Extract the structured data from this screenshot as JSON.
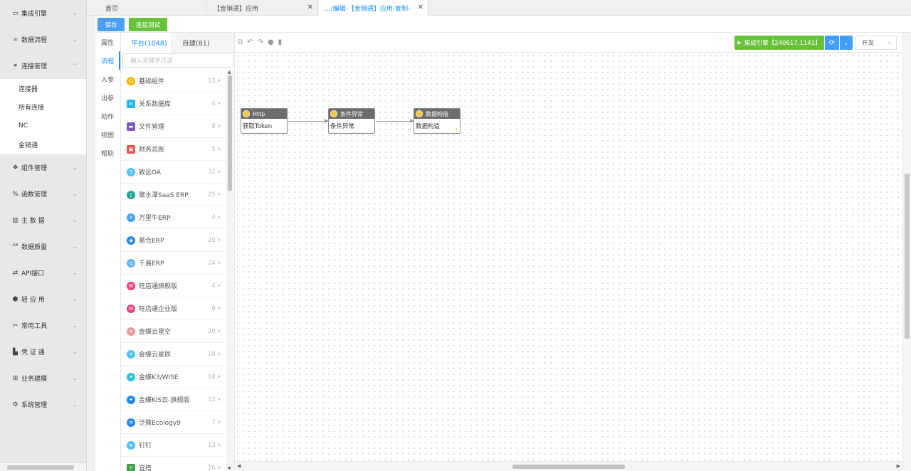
{
  "sidenav": {
    "items": [
      {
        "label": "集成引擎",
        "icon": "engine-icon"
      },
      {
        "label": "数据流程",
        "icon": "infinity-icon"
      },
      {
        "label": "连接管理",
        "icon": "link-icon",
        "expanded": true
      },
      {
        "label": "组件管理",
        "icon": "component-icon"
      },
      {
        "label": "函数管理",
        "icon": "percent-icon"
      },
      {
        "label": "主 数 据",
        "icon": "book-icon"
      },
      {
        "label": "数据质量",
        "icon": "ab-icon"
      },
      {
        "label": "API接口",
        "icon": "swap-icon"
      },
      {
        "label": "轻 应 用",
        "icon": "cube-icon"
      },
      {
        "label": "常用工具",
        "icon": "tools-icon"
      },
      {
        "label": "凭 证 通",
        "icon": "voucher-icon"
      },
      {
        "label": "业务建模",
        "icon": "table-icon"
      },
      {
        "label": "系统管理",
        "icon": "gear-icon"
      }
    ],
    "sub_items": [
      "连接器",
      "所有连接",
      "NC",
      "金销通"
    ]
  },
  "tabs": [
    {
      "label": "首页"
    },
    {
      "label": "【金销通】应用"
    },
    {
      "label": ".../编辑-【金销通】应用-复制-"
    }
  ],
  "toolbar": {
    "save": "保存",
    "test": "连接测试"
  },
  "vtabs": [
    "属性",
    "流程",
    "入参",
    "出参",
    "动作",
    "视图",
    "帮助"
  ],
  "components": {
    "tab_platform": "平台(1048)",
    "tab_custom": "自建(81)",
    "search_placeholder": "输入关键字过滤",
    "items": [
      {
        "label": "基础组件",
        "count": "13",
        "color": "#f5b400"
      },
      {
        "label": "关系数据库",
        "count": "4",
        "color": "#29b6f6"
      },
      {
        "label": "文件管理",
        "count": "8",
        "color": "#7e57c2"
      },
      {
        "label": "财务总账",
        "count": "5",
        "color": "#ef5350"
      },
      {
        "label": "致远OA",
        "count": "32",
        "color": "#4fc3f7"
      },
      {
        "label": "聚水潭SaaS ERP",
        "count": "25",
        "color": "#26a69a"
      },
      {
        "label": "万里牛ERP",
        "count": "4",
        "color": "#42a5f5"
      },
      {
        "label": "易仓ERP",
        "count": "20",
        "color": "#1e88e5"
      },
      {
        "label": "千易ERP",
        "count": "24",
        "color": "#64b5f6"
      },
      {
        "label": "旺店通旗舰版",
        "count": "4",
        "color": "#ec407a"
      },
      {
        "label": "旺店通企业版",
        "count": "8",
        "color": "#ec407a"
      },
      {
        "label": "金蝶云星空",
        "count": "20",
        "color": "#ef9a9a"
      },
      {
        "label": "金蝶云星辰",
        "count": "18",
        "color": "#4fc3f7"
      },
      {
        "label": "金蝶K3/WISE",
        "count": "18",
        "color": "#26c6da"
      },
      {
        "label": "金蝶KIS云-旗舰版",
        "count": "12",
        "color": "#1e88e5"
      },
      {
        "label": "泛微Ecology9",
        "count": "7",
        "color": "#1e88e5"
      },
      {
        "label": "钉钉",
        "count": "13",
        "color": "#4fc3f7"
      },
      {
        "label": "宜搭",
        "count": "16",
        "color": "#43a047"
      }
    ]
  },
  "canvas_bar": {
    "engine": "集成引擎【240617.1141】",
    "env": "开发"
  },
  "nodes": [
    {
      "title": "Http",
      "body": "获取Token"
    },
    {
      "title": "条件异常",
      "body": "条件异常"
    },
    {
      "title": "数据构造",
      "body": "数据构造"
    }
  ]
}
